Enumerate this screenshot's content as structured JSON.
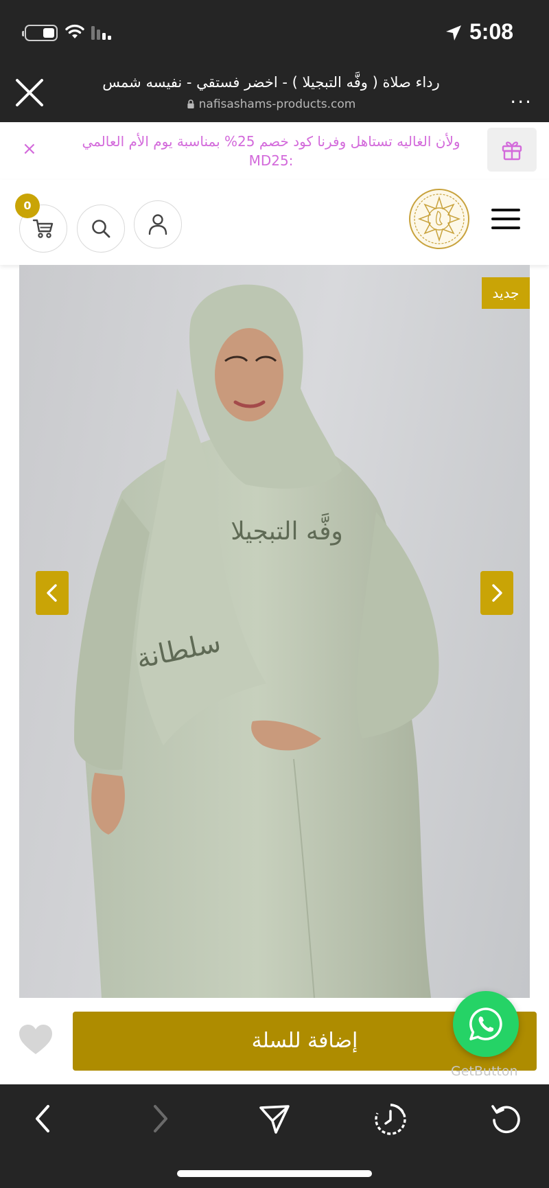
{
  "status_bar": {
    "time": "5:08"
  },
  "browser": {
    "page_title": "رداء صلاة ( وفَّه التبجيلا ) - اخضر فستقي - نفيسه شمس",
    "url": "nafisashams-products.com",
    "more_label": "..."
  },
  "promo": {
    "text": "ولأن الغاليه تستاهل وفرنا كود خصم 25% بمناسبة يوم الأم العالمي :MD25",
    "close_label": "×"
  },
  "header": {
    "cart_count": "0"
  },
  "product": {
    "badge": "جديد",
    "image_alt": "Model wearing pistachio green prayer dress with embroidered Arabic calligraphy",
    "embroidery_1": "وفَّه التبجيلا",
    "embroidery_2": "سلطانة"
  },
  "actions": {
    "add_to_cart_label": "إضافة للسلة",
    "getbutton_label": "GetButton"
  },
  "colors": {
    "accent": "#c9a406",
    "button": "#ae8c00",
    "promo_text": "#d36adb",
    "chrome": "#252525",
    "whatsapp": "#25d366"
  }
}
